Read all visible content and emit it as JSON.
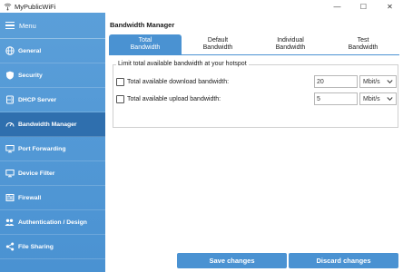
{
  "window": {
    "title": "MyPublicWiFi",
    "controls": {
      "minimize": "—",
      "maximize": "☐",
      "close": "✕"
    }
  },
  "sidebar": {
    "menu_label": "Menu",
    "items": [
      {
        "label": "General",
        "icon": "globe-icon"
      },
      {
        "label": "Security",
        "icon": "shield-icon"
      },
      {
        "label": "DHCP Server",
        "icon": "server-icon"
      },
      {
        "label": "Bandwidth Manager",
        "icon": "speedometer-icon",
        "active": true
      },
      {
        "label": "Port Forwarding",
        "icon": "monitor-icon"
      },
      {
        "label": "Device Filter",
        "icon": "monitor-icon"
      },
      {
        "label": "Firewall",
        "icon": "firewall-icon"
      },
      {
        "label": "Authentication / Design",
        "icon": "user-group-icon"
      },
      {
        "label": "File Sharing",
        "icon": "share-icon"
      }
    ]
  },
  "main": {
    "title": "Bandwidth Manager",
    "tabs": [
      {
        "line1": "Total",
        "line2": "Bandwidth",
        "active": true
      },
      {
        "line1": "Default",
        "line2": "Bandwidth"
      },
      {
        "line1": "Individual",
        "line2": "Bandwidth"
      },
      {
        "line1": "Test",
        "line2": "Bandwidth"
      }
    ],
    "group_title": "Limit total available bandwidth at your hotspot",
    "download": {
      "label": "Total available download bandwidth:",
      "value": "20",
      "unit": "Mbit/s",
      "checked": false
    },
    "upload": {
      "label": "Total available upload bandwidth:",
      "value": "5",
      "unit": "Mbit/s",
      "checked": false
    },
    "save_label": "Save changes",
    "discard_label": "Discard changes"
  },
  "colors": {
    "accent": "#4a92d2",
    "sidebar_active": "#2f6fae",
    "sidebar": "#5b9fd9"
  }
}
